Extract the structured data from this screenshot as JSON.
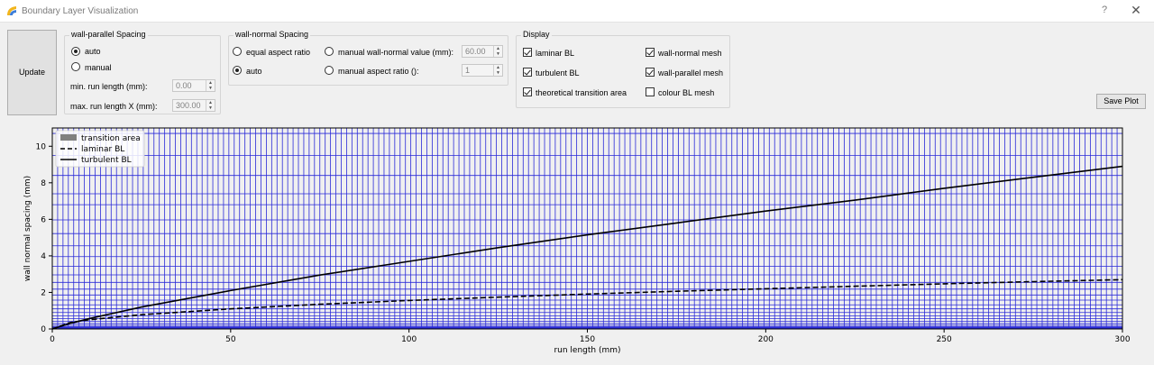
{
  "window": {
    "title": "Boundary Layer Visualization",
    "help_label": "?",
    "close_label": "✕"
  },
  "buttons": {
    "update": "Update",
    "save_plot": "Save Plot"
  },
  "wall_parallel": {
    "title": "wall-parallel Spacing",
    "options": [
      {
        "label": "auto",
        "selected": true
      },
      {
        "label": "manual",
        "selected": false
      }
    ],
    "min_run_label": "min. run length (mm):",
    "min_run_value": "0.00",
    "max_run_label": "max. run length X (mm):",
    "max_run_value": "300.00"
  },
  "wall_normal": {
    "title": "wall-normal Spacing",
    "equal_aspect_label": "equal aspect ratio",
    "auto_label": "auto",
    "manual_value_label": "manual wall-normal value (mm):",
    "manual_value": "60.00",
    "manual_aspect_label": "manual aspect ratio ():",
    "manual_aspect_value": "1"
  },
  "display": {
    "title": "Display",
    "items": [
      {
        "label": "laminar BL",
        "checked": true
      },
      {
        "label": "turbulent BL",
        "checked": true
      },
      {
        "label": "theoretical transition area",
        "checked": true
      },
      {
        "label": "wall-normal mesh",
        "checked": true
      },
      {
        "label": "wall-parallel mesh",
        "checked": true
      },
      {
        "label": "colour BL mesh",
        "checked": false
      }
    ]
  },
  "colors": {
    "mesh": "#2a2ad8",
    "curve": "#000000",
    "transition": "#808080"
  },
  "chart_data": {
    "type": "line",
    "xlabel": "run length (mm)",
    "ylabel": "wall normal spacing (mm)",
    "xlim": [
      0,
      300
    ],
    "ylim": [
      0,
      11
    ],
    "xticks": [
      "0",
      "50",
      "100",
      "150",
      "200",
      "250",
      "300"
    ],
    "yticks": [
      "0",
      "2",
      "4",
      "6",
      "8",
      "10"
    ],
    "legend": {
      "position": "top-left",
      "entries": [
        "transition area",
        "laminar BL",
        "turbulent BL"
      ]
    },
    "series": [
      {
        "name": "laminar BL",
        "style": "dashed",
        "x": [
          0,
          5,
          10,
          25,
          50,
          75,
          100,
          125,
          150,
          175,
          200,
          225,
          250,
          275,
          300
        ],
        "y": [
          0,
          0.35,
          0.5,
          0.78,
          1.1,
          1.35,
          1.56,
          1.74,
          1.91,
          2.06,
          2.2,
          2.34,
          2.47,
          2.59,
          2.7
        ]
      },
      {
        "name": "turbulent BL",
        "style": "solid",
        "x": [
          0,
          5,
          10,
          25,
          50,
          75,
          100,
          125,
          150,
          175,
          200,
          225,
          250,
          275,
          300
        ],
        "y": [
          0,
          0.3,
          0.55,
          1.2,
          2.1,
          2.95,
          3.7,
          4.45,
          5.15,
          5.8,
          6.45,
          7.05,
          7.7,
          8.3,
          8.9
        ]
      }
    ],
    "mesh": {
      "vertical_lines_x": [
        1.5,
        3,
        4.5,
        6,
        7.5,
        9,
        10.5,
        12,
        13.5,
        15,
        16.5,
        18,
        19.5,
        21,
        22.5,
        24,
        25.5,
        27,
        28.5,
        30,
        31.5,
        33,
        34.5,
        36,
        37.5,
        39,
        40.5,
        42,
        43.5,
        45,
        46.5,
        48,
        49.5,
        51,
        52.5,
        54,
        55.5,
        57,
        58.5,
        60,
        61.5,
        63,
        64.5,
        66,
        67.5,
        69,
        70.5,
        72,
        73.5,
        75,
        76.5,
        78,
        79.5,
        81,
        82.5,
        84,
        85.5,
        87,
        88.5,
        90,
        91.5,
        93,
        94.5,
        96,
        97.5,
        99,
        100.5,
        102,
        103.5,
        105,
        106.5,
        108,
        109.5,
        111,
        112.5,
        114,
        115.5,
        117,
        118.5,
        120,
        121.5,
        123,
        124.5,
        126,
        127.5,
        129,
        130.5,
        132,
        133.5,
        135,
        136.5,
        138,
        139.5,
        141,
        142.5,
        144,
        145.5,
        147,
        148.5,
        150,
        151.5,
        153,
        154.5,
        156,
        157.5,
        159,
        160.5,
        162,
        163.5,
        165,
        166.5,
        168,
        169.5,
        171,
        172.5,
        174,
        175.5,
        177,
        178.5,
        180,
        181.5,
        183,
        184.5,
        186,
        187.5,
        189,
        190.5,
        192,
        193.5,
        195,
        196.5,
        198,
        199.5,
        201,
        202.5,
        204,
        205.5,
        207,
        208.5,
        210,
        211.5,
        213,
        214.5,
        216,
        217.5,
        219,
        220.5,
        222,
        223.5,
        225,
        226.5,
        228,
        229.5,
        231,
        232.5,
        234,
        235.5,
        237,
        238.5,
        240,
        241.5,
        243,
        244.5,
        246,
        247.5,
        249,
        250.5,
        252,
        253.5,
        255,
        256.5,
        258,
        259.5,
        261,
        262.5,
        264,
        265.5,
        267,
        268.5,
        270,
        271.5,
        273,
        274.5,
        276,
        277.5,
        279,
        280.5,
        282,
        283.5,
        285,
        286.5,
        288,
        289.5,
        291,
        292.5,
        294,
        295.5,
        297,
        298.5
      ],
      "horizontal_lines_y": [
        0.05,
        0.12,
        0.2,
        0.3,
        0.42,
        0.56,
        0.72,
        0.9,
        1.1,
        1.32,
        1.58,
        1.86,
        2.18,
        2.55,
        2.96,
        3.43,
        3.96,
        4.55,
        5.22,
        5.97,
        6.8,
        7.4,
        8.4,
        9.5,
        10.7
      ]
    }
  }
}
